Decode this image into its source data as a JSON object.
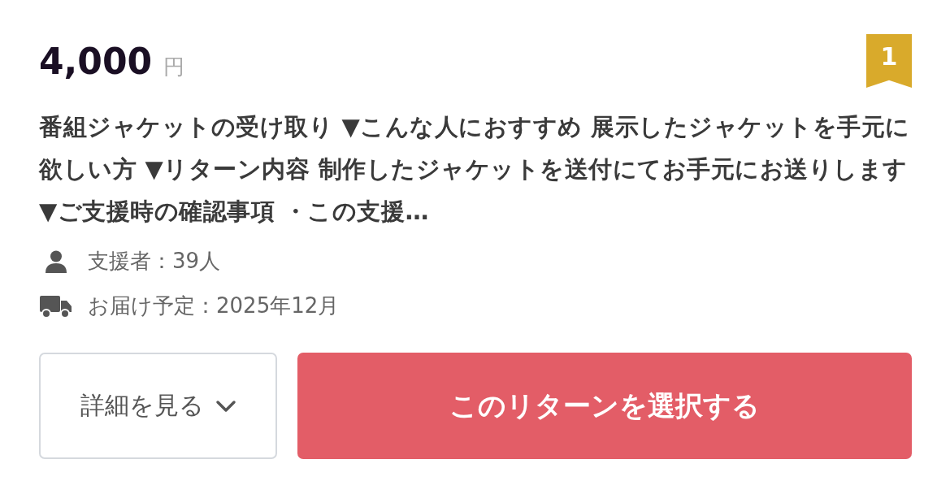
{
  "reward": {
    "price": "4,000",
    "currency": "円",
    "rank": "1",
    "description": "番組ジャケットの受け取り ▼こんな人におすすめ 展示したジャケットを手元に欲しい方 ▼リターン内容 制作したジャケットを送付にてお手元にお送りします ▼ご支援時の確認事項 ・この支援…",
    "meta": [
      {
        "kind": "person",
        "text": "支援者：39人"
      },
      {
        "kind": "truck",
        "text": "お届け予定：2025年12月"
      }
    ],
    "details_button": "詳細を見る",
    "select_button": "このリターンを選択する"
  }
}
